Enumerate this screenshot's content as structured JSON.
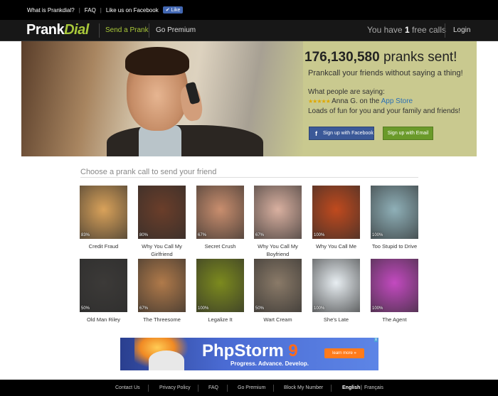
{
  "topbar": {
    "what": "What is Prankdial?",
    "faq": "FAQ",
    "like_text": "Like us on Facebook",
    "like_button": "Like"
  },
  "nav": {
    "logo_prank": "Prank",
    "logo_dial": "Dial",
    "send": "Send a Prank",
    "premium": "Go Premium",
    "free_prefix": "You have",
    "free_count": "1",
    "free_suffix": "free calls",
    "login": "Login"
  },
  "hero": {
    "count": "176,130,580",
    "count_suffix": "pranks sent!",
    "subtitle": "Prankcall your friends without saying a thing!",
    "saying": "What people are saying:",
    "stars": "★★★★★",
    "reviewer": "Anna G. on the",
    "store": "App Store",
    "fun": "Loads of fun for you and your family and friends!",
    "fb_button": "Sign up with Facebook",
    "email_button": "Sign up with Email"
  },
  "section": {
    "choose": "Choose a prank call to send your friend"
  },
  "pranks": [
    {
      "label": "Credit Fraud",
      "pct": "83%",
      "color": "#d9a25a"
    },
    {
      "label": "Why You Call My Girlfriend",
      "pct": "80%",
      "color": "#6b3e2a"
    },
    {
      "label": "Secret Crush",
      "pct": "67%",
      "color": "#c98e6e"
    },
    {
      "label": "Why You Call My Boyfriend",
      "pct": "67%",
      "color": "#d9b0a0"
    },
    {
      "label": "Why You Call Me",
      "pct": "100%",
      "color": "#c04a1e"
    },
    {
      "label": "Too Stupid to Drive",
      "pct": "100%",
      "color": "#8fb0b8"
    },
    {
      "label": "Old Man Riley",
      "pct": "50%",
      "color": "#3c3a38"
    },
    {
      "label": "The Threesome",
      "pct": "67%",
      "color": "#b07a4a"
    },
    {
      "label": "Legalize It",
      "pct": "100%",
      "color": "#7c8a1e"
    },
    {
      "label": "Wart Cream",
      "pct": "50%",
      "color": "#8a7a68"
    },
    {
      "label": "She's Late",
      "pct": "100%",
      "color": "#e8eef2"
    },
    {
      "label": "The Agent",
      "pct": "100%",
      "color": "#c34ac0"
    }
  ],
  "ad": {
    "brand": "PhpStorm",
    "version": "9",
    "tagline": "Progress. Advance. Develop.",
    "learn": "learn more »",
    "adx": "x"
  },
  "footer": {
    "contact": "Contact Us",
    "privacy": "Privacy Policy",
    "faq": "FAQ",
    "premium": "Go Premium",
    "block": "Block My Number",
    "english": "English",
    "sep": "|",
    "francais": "Français"
  },
  "colors": {
    "accent_green": "#a9c83a",
    "hero_bg": "#c9c98f",
    "facebook_blue": "#3b5998",
    "email_green": "#6a9a2a"
  }
}
